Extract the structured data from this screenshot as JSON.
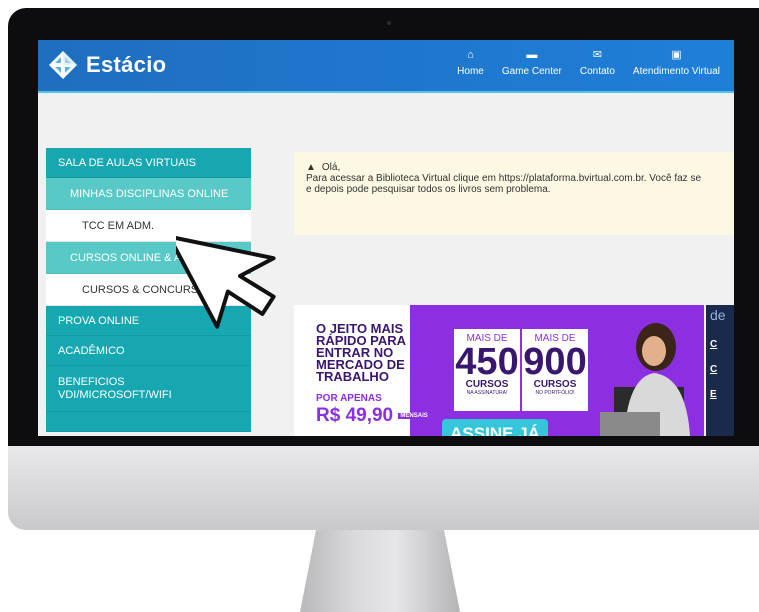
{
  "app": {
    "logo_text": "Estácio",
    "colors": {
      "topbar": "#1f6ec0",
      "sidebar_main": "#16a7b1",
      "sidebar_sub": "#59c9c7",
      "notice_bg": "#fcf8e3",
      "banner_purple": "#8b2fe0"
    }
  },
  "nav": {
    "items": [
      {
        "label": "Home",
        "icon": "home-icon"
      },
      {
        "label": "Game Center",
        "icon": "gamepad-icon"
      },
      {
        "label": "Contato",
        "icon": "mail-icon"
      },
      {
        "label": "Atendimento Virtual",
        "icon": "chat-icon"
      }
    ]
  },
  "sidebar": {
    "items": [
      {
        "label": "SALA DE AULAS VIRTUAIS",
        "level": "main"
      },
      {
        "label": "MINHAS DISCIPLINAS ONLINE",
        "level": "sub"
      },
      {
        "label": "TCC EM ADM.",
        "level": "leaf"
      },
      {
        "label": "CURSOS ONLINE & A",
        "level": "sub"
      },
      {
        "label": "CURSOS & CONCURS",
        "level": "leaf"
      },
      {
        "label": "PROVA ONLINE",
        "level": "main"
      },
      {
        "label": "ACADÊMICO",
        "level": "main"
      },
      {
        "label": "BENEFICIOS VDI/MICROSOFT/WIFI",
        "level": "main"
      }
    ]
  },
  "notice": {
    "greeting": "Olá,",
    "line1": "Para acessar a Biblioteca Virtual clique em https://plataforma.bvirtual.com.br. Você faz se",
    "line2": "e depois pode pesquisar todos os livros sem problema."
  },
  "banner": {
    "headline": "O JEITO MAIS RÁPIDO PARA ENTRAR NO MERCADO DE TRABALHO",
    "from_label": "POR APENAS",
    "price": "R$ 49,90",
    "price_suffix": "MENSAIS",
    "box1": {
      "prefix": "MAIS DE",
      "number": "450",
      "unit": "CURSOS",
      "note": "NA ASSINATURA!"
    },
    "box2": {
      "prefix": "MAIS DE",
      "number": "900",
      "unit": "CURSOS",
      "note": "NO PORTFÓLIO!"
    },
    "cta": "ASSINE JÁ"
  },
  "right_panel": {
    "heading": "de",
    "rows": [
      "C",
      "C",
      "E"
    ]
  }
}
